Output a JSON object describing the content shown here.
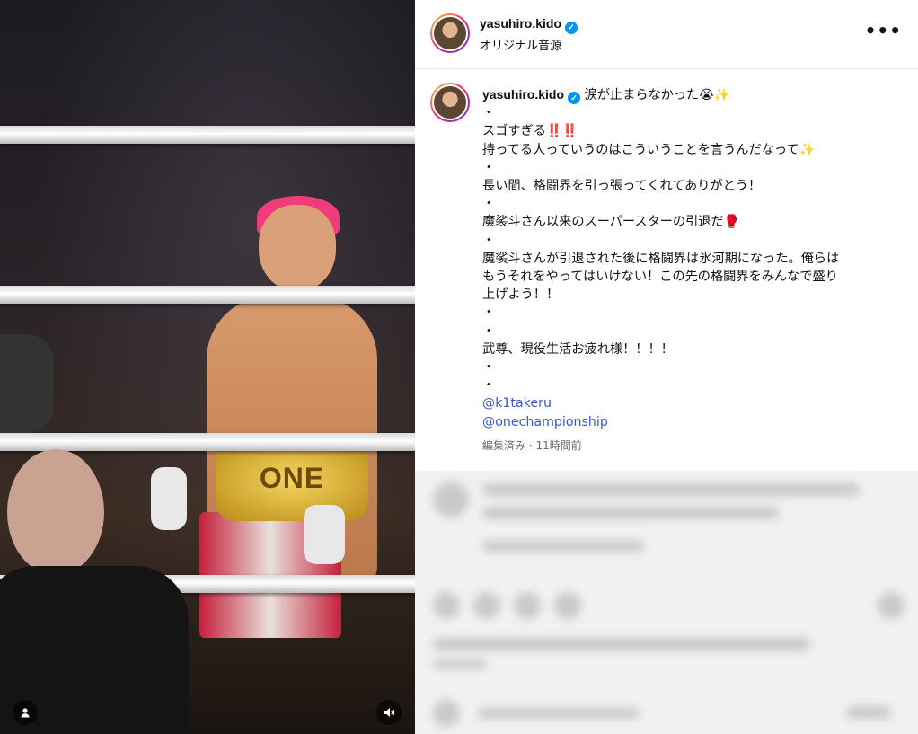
{
  "post": {
    "username": "yasuhiro.kido",
    "audio": "オリジナル音源",
    "caption_first": "涙が止まらなかった😭✨",
    "caption_lines": [
      "・",
      "スゴすぎる‼️‼️",
      "持ってる人っていうのはこういうことを言うんだなって✨",
      "・",
      "長い間、格闘界を引っ張ってくれてありがとう！",
      "・",
      "魔裟斗さん以来のスーパースターの引退だ🥊",
      "・",
      "魔裟斗さんが引退された後に格闘界は氷河期になった。俺らは",
      "もうそれをやってはいけない！この先の格闘界をみんなで盛り",
      "上げよう！！",
      "・",
      "・",
      "武尊、現役生活お疲れ様！！！！",
      "・",
      "・"
    ],
    "mentions": [
      "@k1takeru",
      "@onechampionship"
    ],
    "meta": "編集済み · 11時間前"
  },
  "media": {
    "belt_text": "ONE",
    "user_icon": "user-icon",
    "sound_icon": "speaker-icon"
  },
  "colors": {
    "verified": "#0095f6",
    "mention": "#3a57c8",
    "hair": "#f03c78"
  }
}
